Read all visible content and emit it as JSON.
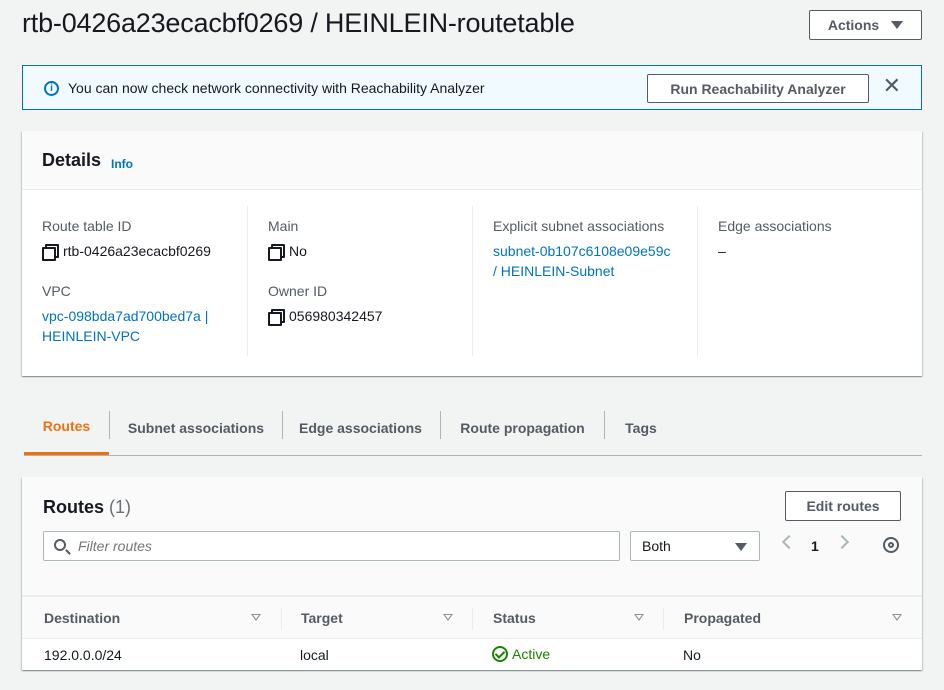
{
  "page": {
    "title": "rtb-0426a23ecacbf0269 / HEINLEIN-routetable",
    "actions_label": "Actions"
  },
  "flash": {
    "message": "You can now check network connectivity with Reachability Analyzer",
    "button_label": "Run Reachability Analyzer",
    "info_icon": "i",
    "close_icon": "✕"
  },
  "details": {
    "title": "Details",
    "info_label": "Info",
    "route_table_id_label": "Route table ID",
    "route_table_id": "rtb-0426a23ecacbf0269",
    "vpc_label": "VPC",
    "vpc_line1": "vpc-098bda7ad700bed7a |",
    "vpc_line2": "HEINLEIN-VPC",
    "main_label": "Main",
    "main_value": "No",
    "owner_id_label": "Owner ID",
    "owner_id": "056980342457",
    "explicit_subnet_label": "Explicit subnet associations",
    "explicit_subnet_line1": "subnet-0b107c6108e09e59c",
    "explicit_subnet_line2": "/ HEINLEIN-Subnet",
    "edge_assoc_label": "Edge associations",
    "edge_assoc_value": "–"
  },
  "tabs": [
    {
      "label": "Routes"
    },
    {
      "label": "Subnet associations"
    },
    {
      "label": "Edge associations"
    },
    {
      "label": "Route propagation"
    },
    {
      "label": "Tags"
    }
  ],
  "routes": {
    "title": "Routes",
    "count": "(1)",
    "edit_label": "Edit routes",
    "search_placeholder": "Filter routes",
    "filter_value": "Both",
    "page_number": "1",
    "columns": [
      "Destination",
      "Target",
      "Status",
      "Propagated"
    ],
    "rows": [
      {
        "destination": "192.0.0.0/24",
        "target": "local",
        "status": "Active",
        "propagated": "No"
      }
    ]
  },
  "colors": {
    "accent_orange": "#ec7211",
    "link_blue": "#0073bb",
    "success_green": "#1d8102"
  }
}
